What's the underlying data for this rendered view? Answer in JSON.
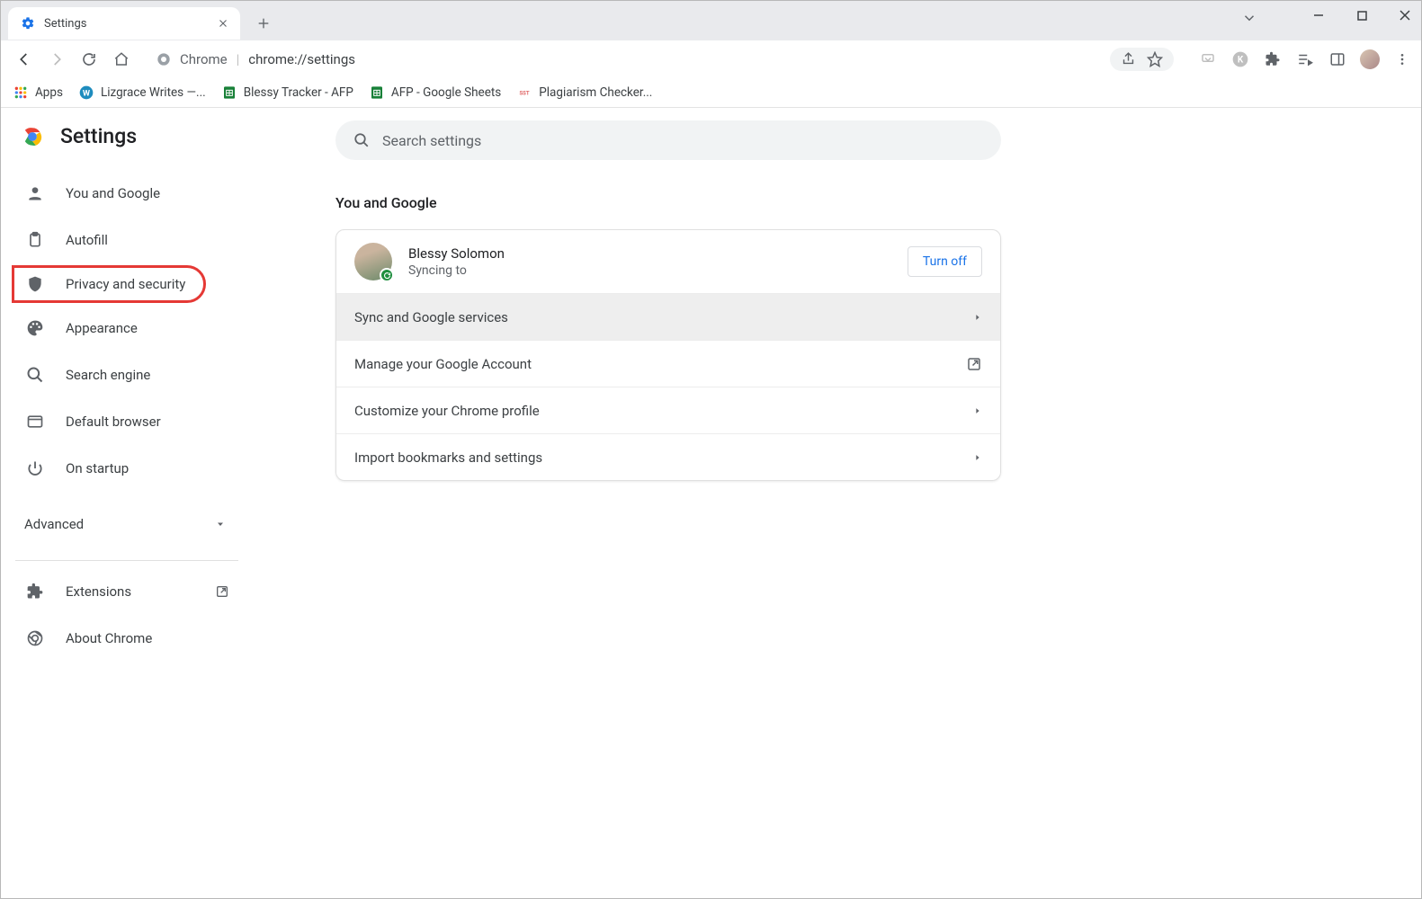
{
  "tab": {
    "title": "Settings"
  },
  "omnibox": {
    "label": "Chrome",
    "url": "chrome://settings"
  },
  "bookmarks": [
    {
      "label": "Apps"
    },
    {
      "label": "Lizgrace Writes —..."
    },
    {
      "label": "Blessy Tracker - AFP"
    },
    {
      "label": "AFP - Google Sheets"
    },
    {
      "label": "Plagiarism Checker..."
    }
  ],
  "app": {
    "title": "Settings"
  },
  "search": {
    "placeholder": "Search settings"
  },
  "nav": {
    "you": "You and Google",
    "autofill": "Autofill",
    "privacy": "Privacy and security",
    "appearance": "Appearance",
    "search_engine": "Search engine",
    "default_browser": "Default browser",
    "on_startup": "On startup",
    "advanced": "Advanced",
    "extensions": "Extensions",
    "about": "About Chrome"
  },
  "section": {
    "title": "You and Google"
  },
  "profile": {
    "name": "Blessy Solomon",
    "status": "Syncing to",
    "turn_off": "Turn off"
  },
  "rows": {
    "sync": "Sync and Google services",
    "manage": "Manage your Google Account",
    "customize": "Customize your Chrome profile",
    "import": "Import bookmarks and settings"
  }
}
